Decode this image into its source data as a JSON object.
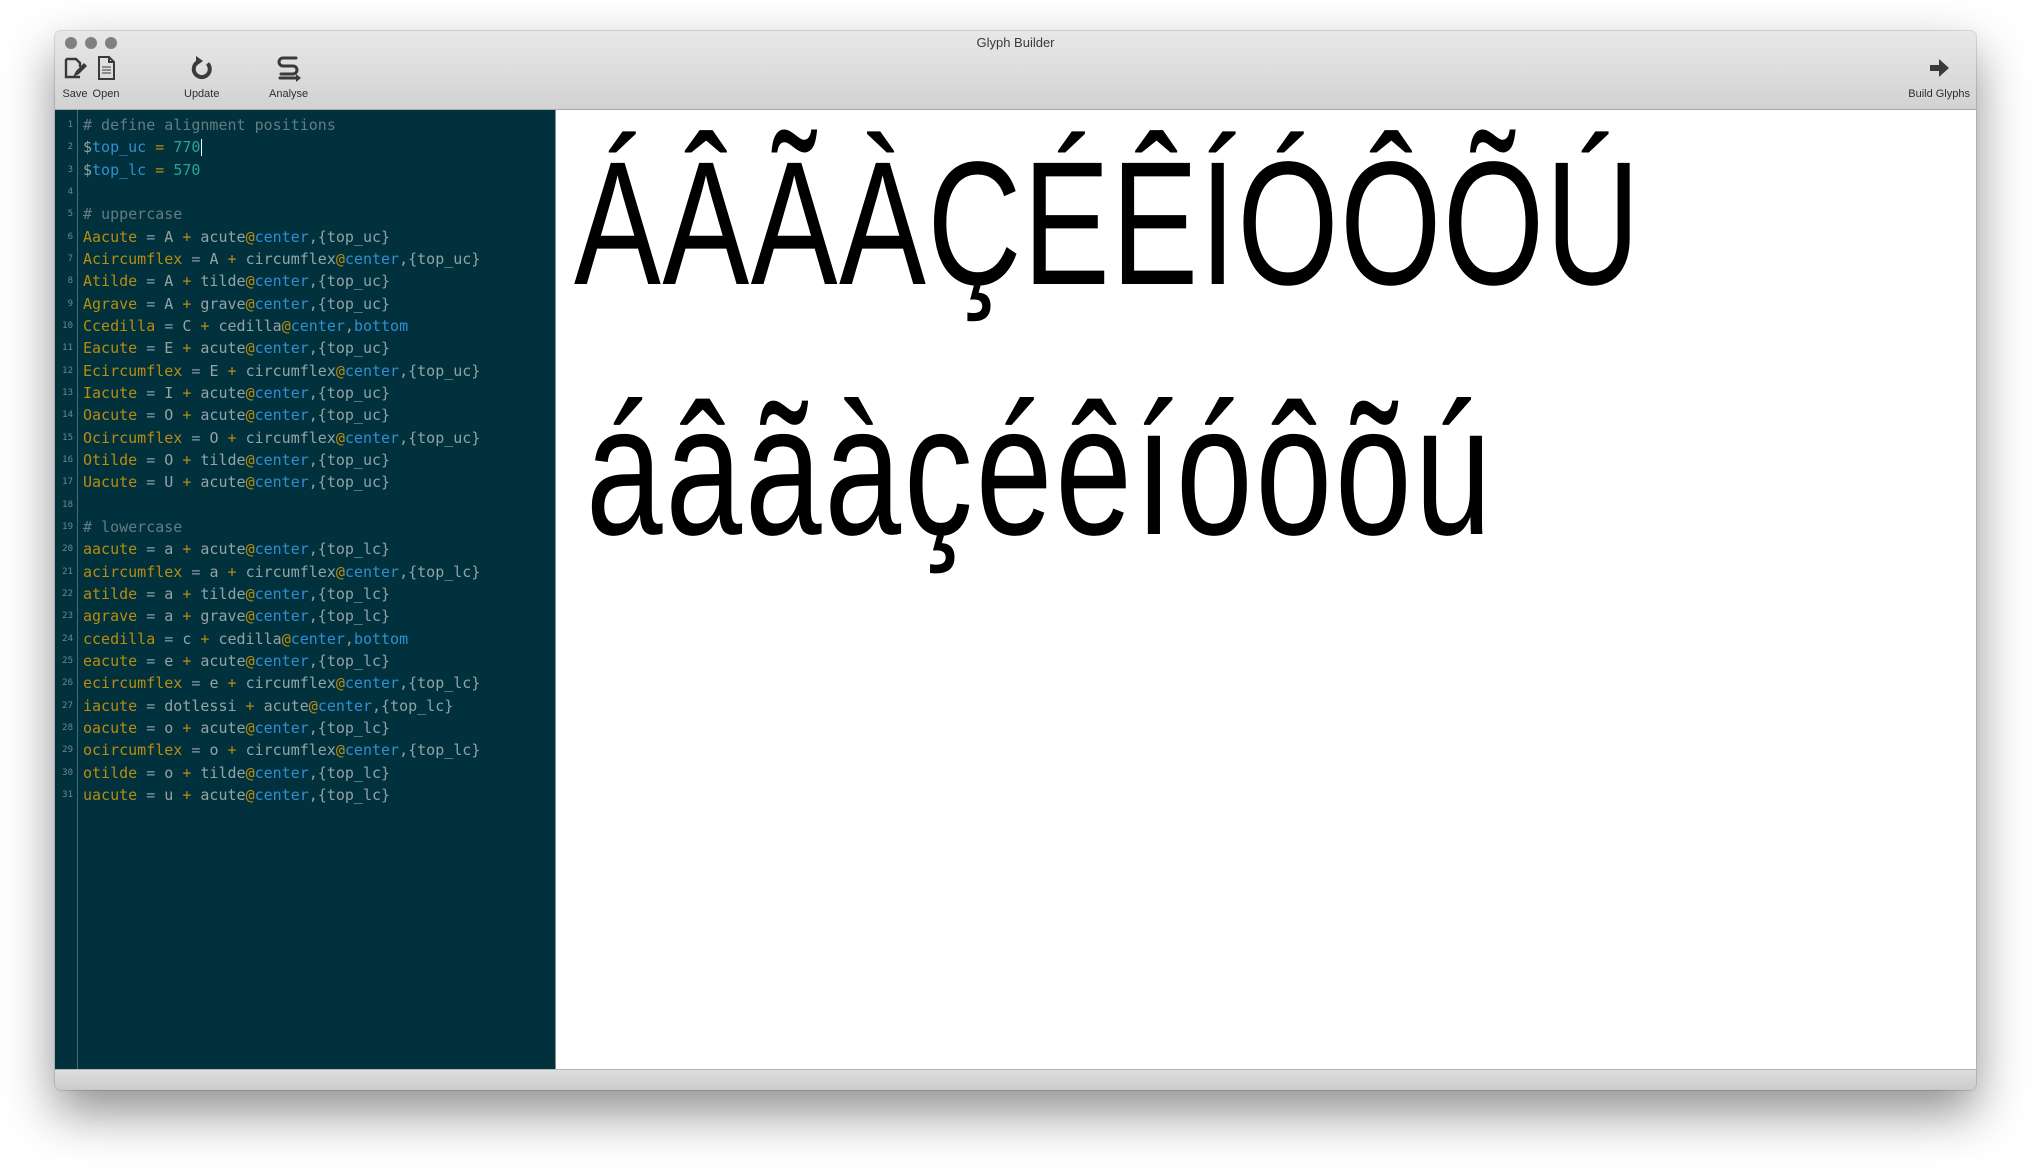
{
  "window": {
    "title": "Glyph Builder"
  },
  "toolbar": {
    "left": [
      {
        "id": "save",
        "label": "Save",
        "icon": "save-icon"
      },
      {
        "id": "open",
        "label": "Open",
        "icon": "document-icon"
      },
      {
        "id": "update",
        "label": "Update",
        "icon": "refresh-icon"
      },
      {
        "id": "analyse",
        "label": "Analyse",
        "icon": "analyse-icon"
      }
    ],
    "right": [
      {
        "id": "build",
        "label": "Build Glyphs",
        "icon": "arrow-right-icon"
      }
    ]
  },
  "editor": {
    "cursor_line": 2,
    "lines": [
      {
        "n": "1",
        "tokens": [
          {
            "t": "# define alignment positions",
            "c": "comment"
          }
        ]
      },
      {
        "n": "2",
        "tokens": [
          {
            "t": "$",
            "c": "dollar"
          },
          {
            "t": "top_uc",
            "c": "var"
          },
          {
            "t": " = ",
            "c": "op"
          },
          {
            "t": "770",
            "c": "num"
          }
        ]
      },
      {
        "n": "3",
        "tokens": [
          {
            "t": "$",
            "c": "dollar"
          },
          {
            "t": "top_lc",
            "c": "var"
          },
          {
            "t": " = ",
            "c": "op"
          },
          {
            "t": "570",
            "c": "num"
          }
        ]
      },
      {
        "n": "4",
        "tokens": []
      },
      {
        "n": "5",
        "tokens": [
          {
            "t": "# uppercase",
            "c": "comment"
          }
        ]
      },
      {
        "n": "6",
        "tokens": [
          {
            "t": "Aacute",
            "c": "name"
          },
          {
            "t": " = ",
            "c": "eq"
          },
          {
            "t": "A",
            "c": "glyph"
          },
          {
            "t": " + ",
            "c": "op"
          },
          {
            "t": "acute",
            "c": "glyph"
          },
          {
            "t": "@",
            "c": "at"
          },
          {
            "t": "center",
            "c": "kw"
          },
          {
            "t": ",{top_uc}",
            "c": "brace"
          }
        ]
      },
      {
        "n": "7",
        "tokens": [
          {
            "t": "Acircumflex",
            "c": "name"
          },
          {
            "t": " = ",
            "c": "eq"
          },
          {
            "t": "A",
            "c": "glyph"
          },
          {
            "t": " + ",
            "c": "op"
          },
          {
            "t": "circumflex",
            "c": "glyph"
          },
          {
            "t": "@",
            "c": "at"
          },
          {
            "t": "center",
            "c": "kw"
          },
          {
            "t": ",{top_uc}",
            "c": "brace"
          }
        ]
      },
      {
        "n": "8",
        "tokens": [
          {
            "t": "Atilde",
            "c": "name"
          },
          {
            "t": " = ",
            "c": "eq"
          },
          {
            "t": "A",
            "c": "glyph"
          },
          {
            "t": " + ",
            "c": "op"
          },
          {
            "t": "tilde",
            "c": "glyph"
          },
          {
            "t": "@",
            "c": "at"
          },
          {
            "t": "center",
            "c": "kw"
          },
          {
            "t": ",{top_uc}",
            "c": "brace"
          }
        ]
      },
      {
        "n": "9",
        "tokens": [
          {
            "t": "Agrave",
            "c": "name"
          },
          {
            "t": " = ",
            "c": "eq"
          },
          {
            "t": "A",
            "c": "glyph"
          },
          {
            "t": " + ",
            "c": "op"
          },
          {
            "t": "grave",
            "c": "glyph"
          },
          {
            "t": "@",
            "c": "at"
          },
          {
            "t": "center",
            "c": "kw"
          },
          {
            "t": ",{top_uc}",
            "c": "brace"
          }
        ]
      },
      {
        "n": "10",
        "tokens": [
          {
            "t": "Ccedilla",
            "c": "name"
          },
          {
            "t": " = ",
            "c": "eq"
          },
          {
            "t": "C",
            "c": "glyph"
          },
          {
            "t": " + ",
            "c": "op"
          },
          {
            "t": "cedilla",
            "c": "glyph"
          },
          {
            "t": "@",
            "c": "at"
          },
          {
            "t": "center",
            "c": "kw"
          },
          {
            "t": ",",
            "c": "brace"
          },
          {
            "t": "bottom",
            "c": "kw"
          }
        ]
      },
      {
        "n": "11",
        "tokens": [
          {
            "t": "Eacute",
            "c": "name"
          },
          {
            "t": " = ",
            "c": "eq"
          },
          {
            "t": "E",
            "c": "glyph"
          },
          {
            "t": " + ",
            "c": "op"
          },
          {
            "t": "acute",
            "c": "glyph"
          },
          {
            "t": "@",
            "c": "at"
          },
          {
            "t": "center",
            "c": "kw"
          },
          {
            "t": ",{top_uc}",
            "c": "brace"
          }
        ]
      },
      {
        "n": "12",
        "tokens": [
          {
            "t": "Ecircumflex",
            "c": "name"
          },
          {
            "t": " = ",
            "c": "eq"
          },
          {
            "t": "E",
            "c": "glyph"
          },
          {
            "t": " + ",
            "c": "op"
          },
          {
            "t": "circumflex",
            "c": "glyph"
          },
          {
            "t": "@",
            "c": "at"
          },
          {
            "t": "center",
            "c": "kw"
          },
          {
            "t": ",{top_uc}",
            "c": "brace"
          }
        ]
      },
      {
        "n": "13",
        "tokens": [
          {
            "t": "Iacute",
            "c": "name"
          },
          {
            "t": " = ",
            "c": "eq"
          },
          {
            "t": "I",
            "c": "glyph"
          },
          {
            "t": " + ",
            "c": "op"
          },
          {
            "t": "acute",
            "c": "glyph"
          },
          {
            "t": "@",
            "c": "at"
          },
          {
            "t": "center",
            "c": "kw"
          },
          {
            "t": ",{top_uc}",
            "c": "brace"
          }
        ]
      },
      {
        "n": "14",
        "tokens": [
          {
            "t": "Oacute",
            "c": "name"
          },
          {
            "t": " = ",
            "c": "eq"
          },
          {
            "t": "O",
            "c": "glyph"
          },
          {
            "t": " + ",
            "c": "op"
          },
          {
            "t": "acute",
            "c": "glyph"
          },
          {
            "t": "@",
            "c": "at"
          },
          {
            "t": "center",
            "c": "kw"
          },
          {
            "t": ",{top_uc}",
            "c": "brace"
          }
        ]
      },
      {
        "n": "15",
        "tokens": [
          {
            "t": "Ocircumflex",
            "c": "name"
          },
          {
            "t": " = ",
            "c": "eq"
          },
          {
            "t": "O",
            "c": "glyph"
          },
          {
            "t": " + ",
            "c": "op"
          },
          {
            "t": "circumflex",
            "c": "glyph"
          },
          {
            "t": "@",
            "c": "at"
          },
          {
            "t": "center",
            "c": "kw"
          },
          {
            "t": ",{top_uc}",
            "c": "brace"
          }
        ]
      },
      {
        "n": "16",
        "tokens": [
          {
            "t": "Otilde",
            "c": "name"
          },
          {
            "t": " = ",
            "c": "eq"
          },
          {
            "t": "O",
            "c": "glyph"
          },
          {
            "t": " + ",
            "c": "op"
          },
          {
            "t": "tilde",
            "c": "glyph"
          },
          {
            "t": "@",
            "c": "at"
          },
          {
            "t": "center",
            "c": "kw"
          },
          {
            "t": ",{top_uc}",
            "c": "brace"
          }
        ]
      },
      {
        "n": "17",
        "tokens": [
          {
            "t": "Uacute",
            "c": "name"
          },
          {
            "t": " = ",
            "c": "eq"
          },
          {
            "t": "U",
            "c": "glyph"
          },
          {
            "t": " + ",
            "c": "op"
          },
          {
            "t": "acute",
            "c": "glyph"
          },
          {
            "t": "@",
            "c": "at"
          },
          {
            "t": "center",
            "c": "kw"
          },
          {
            "t": ",{top_uc}",
            "c": "brace"
          }
        ]
      },
      {
        "n": "18",
        "tokens": []
      },
      {
        "n": "19",
        "tokens": [
          {
            "t": "# lowercase",
            "c": "comment"
          }
        ]
      },
      {
        "n": "20",
        "tokens": [
          {
            "t": "aacute",
            "c": "name"
          },
          {
            "t": " = ",
            "c": "eq"
          },
          {
            "t": "a",
            "c": "glyph"
          },
          {
            "t": " + ",
            "c": "op"
          },
          {
            "t": "acute",
            "c": "glyph"
          },
          {
            "t": "@",
            "c": "at"
          },
          {
            "t": "center",
            "c": "kw"
          },
          {
            "t": ",{top_lc}",
            "c": "brace"
          }
        ]
      },
      {
        "n": "21",
        "tokens": [
          {
            "t": "acircumflex",
            "c": "name"
          },
          {
            "t": " = ",
            "c": "eq"
          },
          {
            "t": "a",
            "c": "glyph"
          },
          {
            "t": " + ",
            "c": "op"
          },
          {
            "t": "circumflex",
            "c": "glyph"
          },
          {
            "t": "@",
            "c": "at"
          },
          {
            "t": "center",
            "c": "kw"
          },
          {
            "t": ",{top_lc}",
            "c": "brace"
          }
        ]
      },
      {
        "n": "22",
        "tokens": [
          {
            "t": "atilde",
            "c": "name"
          },
          {
            "t": " = ",
            "c": "eq"
          },
          {
            "t": "a",
            "c": "glyph"
          },
          {
            "t": " + ",
            "c": "op"
          },
          {
            "t": "tilde",
            "c": "glyph"
          },
          {
            "t": "@",
            "c": "at"
          },
          {
            "t": "center",
            "c": "kw"
          },
          {
            "t": ",{top_lc}",
            "c": "brace"
          }
        ]
      },
      {
        "n": "23",
        "tokens": [
          {
            "t": "agrave",
            "c": "name"
          },
          {
            "t": " = ",
            "c": "eq"
          },
          {
            "t": "a",
            "c": "glyph"
          },
          {
            "t": " + ",
            "c": "op"
          },
          {
            "t": "grave",
            "c": "glyph"
          },
          {
            "t": "@",
            "c": "at"
          },
          {
            "t": "center",
            "c": "kw"
          },
          {
            "t": ",{top_lc}",
            "c": "brace"
          }
        ]
      },
      {
        "n": "24",
        "tokens": [
          {
            "t": "ccedilla",
            "c": "name"
          },
          {
            "t": " = ",
            "c": "eq"
          },
          {
            "t": "c",
            "c": "glyph"
          },
          {
            "t": " + ",
            "c": "op"
          },
          {
            "t": "cedilla",
            "c": "glyph"
          },
          {
            "t": "@",
            "c": "at"
          },
          {
            "t": "center",
            "c": "kw"
          },
          {
            "t": ",",
            "c": "brace"
          },
          {
            "t": "bottom",
            "c": "kw"
          }
        ]
      },
      {
        "n": "25",
        "tokens": [
          {
            "t": "eacute",
            "c": "name"
          },
          {
            "t": " = ",
            "c": "eq"
          },
          {
            "t": "e",
            "c": "glyph"
          },
          {
            "t": " + ",
            "c": "op"
          },
          {
            "t": "acute",
            "c": "glyph"
          },
          {
            "t": "@",
            "c": "at"
          },
          {
            "t": "center",
            "c": "kw"
          },
          {
            "t": ",{top_lc}",
            "c": "brace"
          }
        ]
      },
      {
        "n": "26",
        "tokens": [
          {
            "t": "ecircumflex",
            "c": "name"
          },
          {
            "t": " = ",
            "c": "eq"
          },
          {
            "t": "e",
            "c": "glyph"
          },
          {
            "t": " + ",
            "c": "op"
          },
          {
            "t": "circumflex",
            "c": "glyph"
          },
          {
            "t": "@",
            "c": "at"
          },
          {
            "t": "center",
            "c": "kw"
          },
          {
            "t": ",{top_lc}",
            "c": "brace"
          }
        ]
      },
      {
        "n": "27",
        "tokens": [
          {
            "t": "iacute",
            "c": "name"
          },
          {
            "t": " = ",
            "c": "eq"
          },
          {
            "t": "dotlessi",
            "c": "glyph"
          },
          {
            "t": " + ",
            "c": "op"
          },
          {
            "t": "acute",
            "c": "glyph"
          },
          {
            "t": "@",
            "c": "at"
          },
          {
            "t": "center",
            "c": "kw"
          },
          {
            "t": ",{top_lc}",
            "c": "brace"
          }
        ]
      },
      {
        "n": "28",
        "tokens": [
          {
            "t": "oacute",
            "c": "name"
          },
          {
            "t": " = ",
            "c": "eq"
          },
          {
            "t": "o",
            "c": "glyph"
          },
          {
            "t": " + ",
            "c": "op"
          },
          {
            "t": "acute",
            "c": "glyph"
          },
          {
            "t": "@",
            "c": "at"
          },
          {
            "t": "center",
            "c": "kw"
          },
          {
            "t": ",{top_lc}",
            "c": "brace"
          }
        ]
      },
      {
        "n": "29",
        "tokens": [
          {
            "t": "ocircumflex",
            "c": "name"
          },
          {
            "t": " = ",
            "c": "eq"
          },
          {
            "t": "o",
            "c": "glyph"
          },
          {
            "t": " + ",
            "c": "op"
          },
          {
            "t": "circumflex",
            "c": "glyph"
          },
          {
            "t": "@",
            "c": "at"
          },
          {
            "t": "center",
            "c": "kw"
          },
          {
            "t": ",{top_lc}",
            "c": "brace"
          }
        ]
      },
      {
        "n": "30",
        "tokens": [
          {
            "t": "otilde",
            "c": "name"
          },
          {
            "t": " = ",
            "c": "eq"
          },
          {
            "t": "o",
            "c": "glyph"
          },
          {
            "t": " + ",
            "c": "op"
          },
          {
            "t": "tilde",
            "c": "glyph"
          },
          {
            "t": "@",
            "c": "at"
          },
          {
            "t": "center",
            "c": "kw"
          },
          {
            "t": ",{top_lc}",
            "c": "brace"
          }
        ]
      },
      {
        "n": "31",
        "tokens": [
          {
            "t": "uacute",
            "c": "name"
          },
          {
            "t": " = ",
            "c": "eq"
          },
          {
            "t": "u",
            "c": "glyph"
          },
          {
            "t": " + ",
            "c": "op"
          },
          {
            "t": "acute",
            "c": "glyph"
          },
          {
            "t": "@",
            "c": "at"
          },
          {
            "t": "center",
            "c": "kw"
          },
          {
            "t": ",{top_lc}",
            "c": "brace"
          }
        ]
      }
    ]
  },
  "preview": {
    "uppercase": [
      "Á",
      "Â",
      "Ã",
      "À",
      "Ç",
      "É",
      "Ê",
      "Í",
      "Ó",
      "Ô",
      "Õ",
      "Ú"
    ],
    "uppercase_shown": "ÁÂÃÀÇÉÊÍÓÔÕÚ",
    "lowercase": [
      "á",
      "â",
      "ã",
      "à",
      "ç",
      "é",
      "ê",
      "í",
      "ó",
      "ô",
      "õ",
      "ú"
    ],
    "lowercase_shown": "áâãàçéêíóôõú"
  }
}
